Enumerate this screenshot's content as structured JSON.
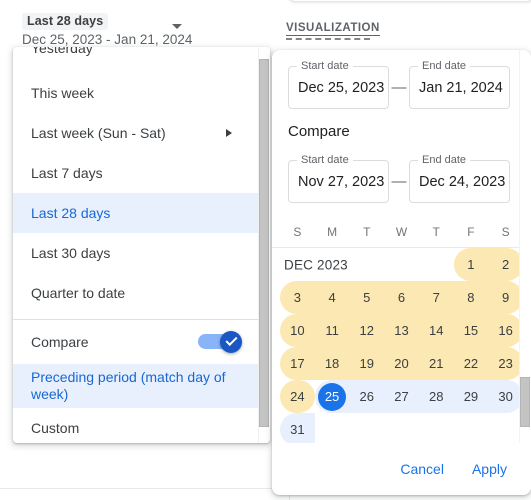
{
  "date_control": {
    "chip_label": "Last 28 days",
    "range_text": "Dec 25, 2023 - Jan 21, 2024",
    "caret_icon": "chevron-down-icon"
  },
  "section": {
    "viz_label": "VISUALIZATION"
  },
  "menu": {
    "items": [
      {
        "label": "Yesterday",
        "state": "partial",
        "submenu": false
      },
      {
        "label": "This week",
        "state": "normal",
        "submenu": false
      },
      {
        "label": "Last week (Sun - Sat)",
        "state": "normal",
        "submenu": true
      },
      {
        "label": "Last 7 days",
        "state": "normal",
        "submenu": false
      },
      {
        "label": "Last 28 days",
        "state": "selected",
        "submenu": false
      },
      {
        "label": "Last 30 days",
        "state": "normal",
        "submenu": false
      },
      {
        "label": "Quarter to date",
        "state": "normal",
        "submenu": false
      }
    ],
    "compare": {
      "label": "Compare",
      "toggle_on": true,
      "toggle_icon": "check-icon"
    },
    "compare_options": [
      {
        "label": "Preceding period (match day of week)",
        "state": "selected"
      },
      {
        "label": "Custom",
        "state": "normal"
      }
    ]
  },
  "panel": {
    "primary": {
      "start_label": "Start date",
      "start_value": "Dec 25, 2023",
      "separator": "—",
      "end_label": "End date",
      "end_value": "Jan 21, 2024"
    },
    "compare_title": "Compare",
    "compare": {
      "start_label": "Start date",
      "start_value": "Nov 27, 2023",
      "separator": "—",
      "end_label": "End date",
      "end_value": "Dec 24, 2023"
    },
    "weekdays": [
      "S",
      "M",
      "T",
      "W",
      "T",
      "F",
      "S"
    ],
    "month_label": "DEC 2023",
    "weeks": [
      [
        {
          "day": "",
          "kind": "empty",
          "label": true
        },
        {
          "day": "",
          "kind": "empty"
        },
        {
          "day": "",
          "kind": "empty"
        },
        {
          "day": "",
          "kind": "empty"
        },
        {
          "day": "",
          "kind": "empty"
        },
        {
          "day": "1",
          "kind": "cmp cmp-start"
        },
        {
          "day": "2",
          "kind": "cmp cmp-end"
        }
      ],
      [
        {
          "day": "3",
          "kind": "cmp cmp-start"
        },
        {
          "day": "4",
          "kind": "cmp"
        },
        {
          "day": "5",
          "kind": "cmp"
        },
        {
          "day": "6",
          "kind": "cmp"
        },
        {
          "day": "7",
          "kind": "cmp"
        },
        {
          "day": "8",
          "kind": "cmp"
        },
        {
          "day": "9",
          "kind": "cmp cmp-end"
        }
      ],
      [
        {
          "day": "10",
          "kind": "cmp cmp-start"
        },
        {
          "day": "11",
          "kind": "cmp"
        },
        {
          "day": "12",
          "kind": "cmp"
        },
        {
          "day": "13",
          "kind": "cmp"
        },
        {
          "day": "14",
          "kind": "cmp"
        },
        {
          "day": "15",
          "kind": "cmp"
        },
        {
          "day": "16",
          "kind": "cmp cmp-end"
        }
      ],
      [
        {
          "day": "17",
          "kind": "cmp cmp-start"
        },
        {
          "day": "18",
          "kind": "cmp"
        },
        {
          "day": "19",
          "kind": "cmp"
        },
        {
          "day": "20",
          "kind": "cmp"
        },
        {
          "day": "21",
          "kind": "cmp"
        },
        {
          "day": "22",
          "kind": "cmp"
        },
        {
          "day": "23",
          "kind": "cmp cmp-end"
        }
      ],
      [
        {
          "day": "24",
          "kind": "cmp cmp-start cmp-end"
        },
        {
          "day": "25",
          "kind": "sel sel-start today-sel"
        },
        {
          "day": "26",
          "kind": "sel"
        },
        {
          "day": "27",
          "kind": "sel"
        },
        {
          "day": "28",
          "kind": "sel"
        },
        {
          "day": "29",
          "kind": "sel"
        },
        {
          "day": "30",
          "kind": "sel sel-end"
        }
      ],
      [
        {
          "day": "31",
          "kind": "sel sel-start"
        },
        {
          "day": "",
          "kind": "empty"
        },
        {
          "day": "",
          "kind": "empty"
        },
        {
          "day": "",
          "kind": "empty"
        },
        {
          "day": "",
          "kind": "empty"
        },
        {
          "day": "",
          "kind": "empty"
        },
        {
          "day": "",
          "kind": "empty"
        }
      ]
    ],
    "footer": {
      "cancel_label": "Cancel",
      "apply_label": "Apply"
    }
  },
  "colors": {
    "accent_blue": "#1a73e8",
    "selected_row_bg": "#e8f0fe",
    "selected_text": "#1967d2",
    "compare_range_bg": "#fce8b2",
    "toggle_track": "#8ab4f8",
    "toggle_thumb": "#1a56c4"
  }
}
